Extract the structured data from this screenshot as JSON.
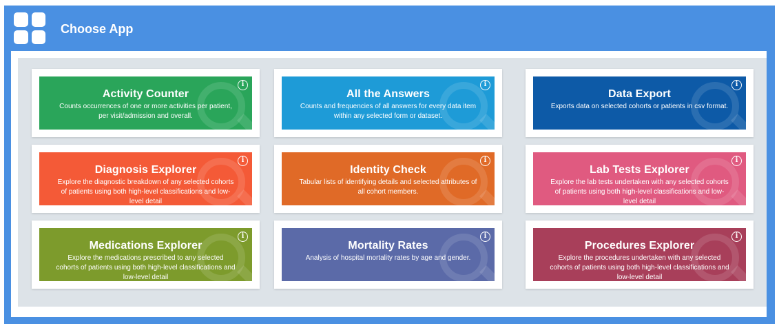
{
  "header": {
    "title": "Choose App",
    "icon": "app-grid-icon"
  },
  "colors": {
    "header_bg": "#4a90e2",
    "panel_bg": "#dde3e8"
  },
  "apps": [
    {
      "title": "Activity Counter",
      "description": "Counts occurrences of one or more activities per patient, per visit/admission and overall.",
      "color": "#2aa55a",
      "icon": "activity-watermark-icon"
    },
    {
      "title": "All the Answers",
      "description": "Counts and frequencies of all answers for every data item within any selected form or dataset.",
      "color": "#1e9bd7",
      "icon": "chart-watermark-icon"
    },
    {
      "title": "Data Export",
      "description": "Exports data on selected cohorts or patients in csv format.",
      "color": "#0d5aa7",
      "icon": "database-watermark-icon"
    },
    {
      "title": "Diagnosis Explorer",
      "description": "Explore the diagnostic breakdown of any selected cohorts of patients using both high-level classifications and low-level detail",
      "color": "#f45a37",
      "icon": "stethoscope-watermark-icon"
    },
    {
      "title": "Identity Check",
      "description": "Tabular lists of identifying details and selected attributes of all cohort members.",
      "color": "#e06a27",
      "icon": "id-card-watermark-icon"
    },
    {
      "title": "Lab Tests Explorer",
      "description": "Explore the lab tests undertaken with any selected cohorts of patients using both high-level classifications and low-level detail",
      "color": "#e05a80",
      "icon": "flask-watermark-icon"
    },
    {
      "title": "Medications Explorer",
      "description": "Explore the medications prescribed to any selected cohorts of patients using both high-level classifications and low-level detail",
      "color": "#7d9b2c",
      "icon": "pill-watermark-icon"
    },
    {
      "title": "Mortality Rates",
      "description": "Analysis of hospital mortality rates by age and gender.",
      "color": "#5b6aa8",
      "icon": "line-chart-watermark-icon"
    },
    {
      "title": "Procedures Explorer",
      "description": "Explore the procedures undertaken with any selected cohorts of patients using both high-level classifications and low-level detail",
      "color": "#a83f5a",
      "icon": "heart-watermark-icon"
    }
  ],
  "info_glyph": "i"
}
